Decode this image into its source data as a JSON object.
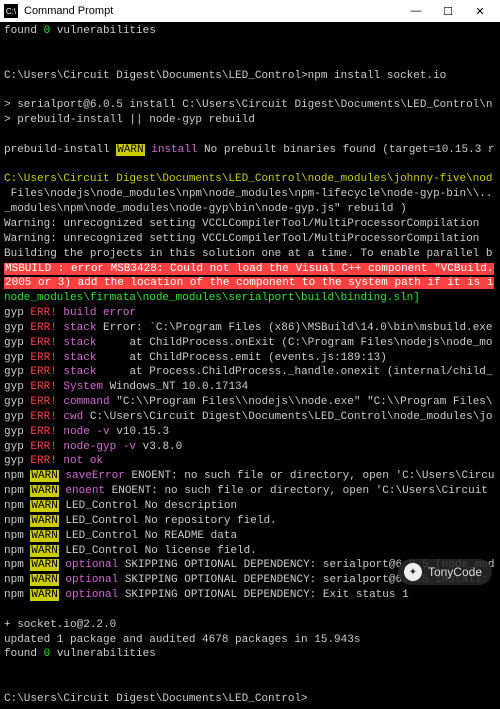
{
  "window": {
    "title": "Command Prompt",
    "icon_label": "C:\\"
  },
  "terminal": {
    "lines": [
      {
        "segments": [
          {
            "t": "found "
          },
          {
            "t": "0",
            "c": "g"
          },
          {
            "t": " vulnerabilities"
          }
        ]
      },
      {
        "segments": [
          {
            "t": ""
          }
        ]
      },
      {
        "segments": [
          {
            "t": ""
          }
        ]
      },
      {
        "segments": [
          {
            "t": "C:\\Users\\Circuit Digest\\Documents\\LED_Control>npm install socket.io"
          }
        ]
      },
      {
        "segments": [
          {
            "t": ""
          }
        ]
      },
      {
        "segments": [
          {
            "t": "> serialport@6.0.5 install C:\\Users\\Circuit Digest\\Documents\\LED_Control\\n"
          }
        ]
      },
      {
        "segments": [
          {
            "t": "> prebuild-install || node-gyp rebuild"
          }
        ]
      },
      {
        "segments": [
          {
            "t": ""
          }
        ]
      },
      {
        "segments": [
          {
            "t": "prebuild-install "
          },
          {
            "t": "WARN",
            "c": "hl-y"
          },
          {
            "t": " "
          },
          {
            "t": "install",
            "c": "m"
          },
          {
            "t": " No prebuilt binaries found (target=10.15.3 r"
          }
        ]
      },
      {
        "segments": [
          {
            "t": ""
          }
        ]
      },
      {
        "segments": [
          {
            "t": "C:\\Users\\Circuit Digest\\Documents\\LED_Control\\node_modules\\johnny-five\\nod",
            "c": "y"
          }
        ]
      },
      {
        "segments": [
          {
            "t": " Files\\nodejs\\node_modules\\npm\\node_modules\\npm-lifecycle\\node-gyp-bin\\\\.."
          }
        ]
      },
      {
        "segments": [
          {
            "t": "_modules\\npm\\node_modules\\node-gyp\\bin\\node-gyp.js\" rebuild )"
          }
        ]
      },
      {
        "segments": [
          {
            "t": "Warning: unrecognized setting VCCLCompilerTool/MultiProcessorCompilation"
          }
        ]
      },
      {
        "segments": [
          {
            "t": "Warning: unrecognized setting VCCLCompilerTool/MultiProcessorCompilation"
          }
        ]
      },
      {
        "segments": [
          {
            "t": "Building the projects in this solution one at a time. To enable parallel b"
          }
        ]
      },
      {
        "segments": [
          {
            "t": "MSBUILD : error MSB3428: Could not load the Visual C++ component \"VCBuild.",
            "c": "hl-r"
          }
        ]
      },
      {
        "segments": [
          {
            "t": "2005 or 3) add the location of the component to the system path if it is i",
            "c": "hl-r"
          }
        ]
      },
      {
        "segments": [
          {
            "t": "node_modules\\firmata\\node_modules\\serialport\\build\\binding.sln]",
            "c": "g"
          }
        ]
      },
      {
        "segments": [
          {
            "t": "gyp "
          },
          {
            "t": "ERR!",
            "c": "r"
          },
          {
            "t": " "
          },
          {
            "t": "build error",
            "c": "m"
          }
        ]
      },
      {
        "segments": [
          {
            "t": "gyp "
          },
          {
            "t": "ERR!",
            "c": "r"
          },
          {
            "t": " "
          },
          {
            "t": "stack",
            "c": "m"
          },
          {
            "t": " Error: `C:\\Program Files (x86)\\MSBuild\\14.0\\bin\\msbuild.exe"
          }
        ]
      },
      {
        "segments": [
          {
            "t": "gyp "
          },
          {
            "t": "ERR!",
            "c": "r"
          },
          {
            "t": " "
          },
          {
            "t": "stack",
            "c": "m"
          },
          {
            "t": "     at ChildProcess.onExit (C:\\Program Files\\nodejs\\node_mo"
          }
        ]
      },
      {
        "segments": [
          {
            "t": "gyp "
          },
          {
            "t": "ERR!",
            "c": "r"
          },
          {
            "t": " "
          },
          {
            "t": "stack",
            "c": "m"
          },
          {
            "t": "     at ChildProcess.emit (events.js:189:13)"
          }
        ]
      },
      {
        "segments": [
          {
            "t": "gyp "
          },
          {
            "t": "ERR!",
            "c": "r"
          },
          {
            "t": " "
          },
          {
            "t": "stack",
            "c": "m"
          },
          {
            "t": "     at Process.ChildProcess._handle.onexit (internal/child_"
          }
        ]
      },
      {
        "segments": [
          {
            "t": "gyp "
          },
          {
            "t": "ERR!",
            "c": "r"
          },
          {
            "t": " "
          },
          {
            "t": "System",
            "c": "m"
          },
          {
            "t": " Windows_NT 10.0.17134"
          }
        ]
      },
      {
        "segments": [
          {
            "t": "gyp "
          },
          {
            "t": "ERR!",
            "c": "r"
          },
          {
            "t": " "
          },
          {
            "t": "command",
            "c": "m"
          },
          {
            "t": " \"C:\\\\Program Files\\\\nodejs\\\\node.exe\" \"C:\\\\Program Files\\"
          }
        ]
      },
      {
        "segments": [
          {
            "t": "gyp "
          },
          {
            "t": "ERR!",
            "c": "r"
          },
          {
            "t": " "
          },
          {
            "t": "cwd",
            "c": "m"
          },
          {
            "t": " C:\\Users\\Circuit Digest\\Documents\\LED_Control\\node_modules\\jo"
          }
        ]
      },
      {
        "segments": [
          {
            "t": "gyp "
          },
          {
            "t": "ERR!",
            "c": "r"
          },
          {
            "t": " "
          },
          {
            "t": "node -v",
            "c": "m"
          },
          {
            "t": " v10.15.3"
          }
        ]
      },
      {
        "segments": [
          {
            "t": "gyp "
          },
          {
            "t": "ERR!",
            "c": "r"
          },
          {
            "t": " "
          },
          {
            "t": "node-gyp -v",
            "c": "m"
          },
          {
            "t": " v3.8.0"
          }
        ]
      },
      {
        "segments": [
          {
            "t": "gyp "
          },
          {
            "t": "ERR!",
            "c": "r"
          },
          {
            "t": " "
          },
          {
            "t": "not ok",
            "c": "m"
          }
        ]
      },
      {
        "segments": [
          {
            "t": "npm "
          },
          {
            "t": "WARN",
            "c": "hl-y"
          },
          {
            "t": " "
          },
          {
            "t": "saveError",
            "c": "m"
          },
          {
            "t": " ENOENT: no such file or directory, open 'C:\\Users\\Circu"
          }
        ]
      },
      {
        "segments": [
          {
            "t": "npm "
          },
          {
            "t": "WARN",
            "c": "hl-y"
          },
          {
            "t": " "
          },
          {
            "t": "enoent",
            "c": "m"
          },
          {
            "t": " ENOENT: no such file or directory, open 'C:\\Users\\Circuit "
          }
        ]
      },
      {
        "segments": [
          {
            "t": "npm "
          },
          {
            "t": "WARN",
            "c": "hl-y"
          },
          {
            "t": " LED_Control No description"
          }
        ]
      },
      {
        "segments": [
          {
            "t": "npm "
          },
          {
            "t": "WARN",
            "c": "hl-y"
          },
          {
            "t": " LED_Control No repository field."
          }
        ]
      },
      {
        "segments": [
          {
            "t": "npm "
          },
          {
            "t": "WARN",
            "c": "hl-y"
          },
          {
            "t": " LED_Control No README data"
          }
        ]
      },
      {
        "segments": [
          {
            "t": "npm "
          },
          {
            "t": "WARN",
            "c": "hl-y"
          },
          {
            "t": " LED_Control No license field."
          }
        ]
      },
      {
        "segments": [
          {
            "t": "npm "
          },
          {
            "t": "WARN",
            "c": "hl-y"
          },
          {
            "t": " "
          },
          {
            "t": "optional",
            "c": "m"
          },
          {
            "t": " SKIPPING OPTIONAL DEPENDENCY: serialport@6.0.5 (node_mod"
          }
        ]
      },
      {
        "segments": [
          {
            "t": "npm "
          },
          {
            "t": "WARN",
            "c": "hl-y"
          },
          {
            "t": " "
          },
          {
            "t": "optional",
            "c": "m"
          },
          {
            "t": " SKIPPING OPTIONAL DEPENDENCY: serialport@6.0.5 install:"
          }
        ]
      },
      {
        "segments": [
          {
            "t": "npm "
          },
          {
            "t": "WARN",
            "c": "hl-y"
          },
          {
            "t": " "
          },
          {
            "t": "optional",
            "c": "m"
          },
          {
            "t": " SKIPPING OPTIONAL DEPENDENCY: Exit status 1"
          }
        ]
      },
      {
        "segments": [
          {
            "t": ""
          }
        ]
      },
      {
        "segments": [
          {
            "t": "+ socket.io@2.2.0"
          }
        ]
      },
      {
        "segments": [
          {
            "t": "updated 1 package and audited 4678 packages in 15.943s"
          }
        ]
      },
      {
        "segments": [
          {
            "t": "found "
          },
          {
            "t": "0",
            "c": "g"
          },
          {
            "t": " vulnerabilities"
          }
        ]
      },
      {
        "segments": [
          {
            "t": ""
          }
        ]
      },
      {
        "segments": [
          {
            "t": ""
          }
        ]
      },
      {
        "segments": [
          {
            "t": "C:\\Users\\Circuit Digest\\Documents\\LED_Control>"
          }
        ]
      }
    ]
  },
  "watermark": {
    "text": "TonyCode"
  }
}
